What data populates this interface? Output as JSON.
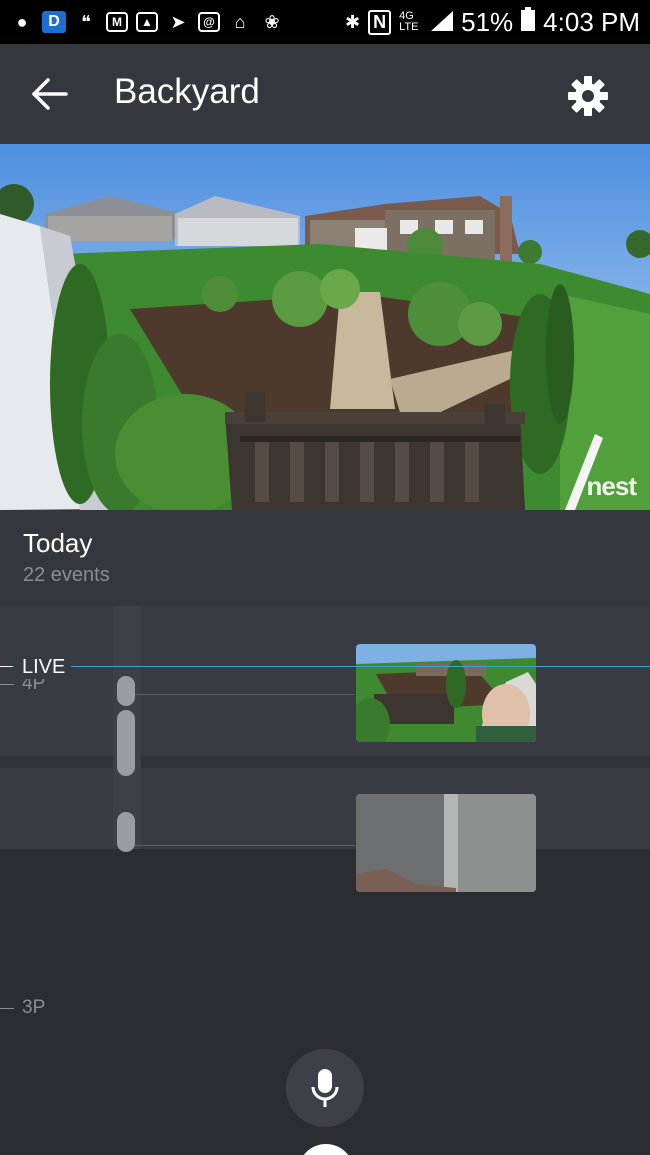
{
  "status_bar": {
    "battery": "51%",
    "time": "4:03 PM",
    "network": "4G LTE"
  },
  "header": {
    "title": "Backyard",
    "back_icon": "arrow-left-icon",
    "settings_icon": "gear-icon"
  },
  "feed": {
    "watermark": "nest"
  },
  "timeline": {
    "day_label": "Today",
    "event_count": "22 events",
    "live_label": "LIVE",
    "hour_labels": [
      "4P",
      "3P"
    ]
  },
  "colors": {
    "background": "#2b2d33",
    "appbar": "#34373e",
    "live_line": "#35a7d6"
  }
}
